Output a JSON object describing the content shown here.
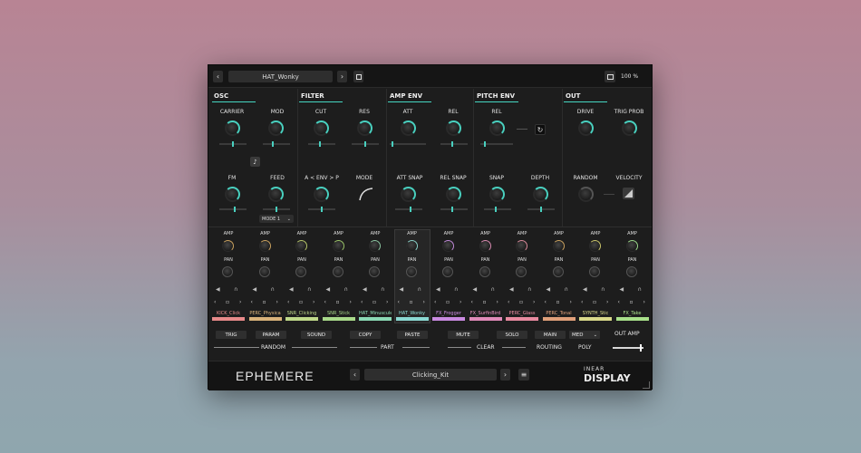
{
  "top": {
    "preset": "HAT_Wonky",
    "zoom": "100 %"
  },
  "sections": {
    "osc": "OSC",
    "filter": "FILTER",
    "amp_env": "AMP ENV",
    "pitch_env": "PITCH ENV",
    "out": "OUT"
  },
  "osc": {
    "carrier": "CARRIER",
    "mod": "MOD",
    "fm": "FM",
    "feed": "FEED",
    "mode": "MODE 1"
  },
  "filter": {
    "cut": "CUT",
    "res": "RES",
    "env": "A < ENV > P",
    "mode": "MODE"
  },
  "amp_env": {
    "att": "ATT",
    "rel": "REL",
    "att_snap": "ATT SNAP",
    "rel_snap": "REL SNAP"
  },
  "pitch_env": {
    "rel": "REL",
    "snap": "SNAP",
    "depth": "DEPTH"
  },
  "out": {
    "drive": "DRIVE",
    "trig_prob": "TRIG PROB",
    "random": "RANDOM",
    "velocity": "VELOCITY"
  },
  "channel_labels": {
    "amp": "AMP",
    "pan": "PAN"
  },
  "channels": [
    {
      "name": "KICK_Click",
      "color": "#e88a8a"
    },
    {
      "name": "PERC_Physica",
      "color": "#d9b27a"
    },
    {
      "name": "SNR_Clicking",
      "color": "#bfd98a"
    },
    {
      "name": "SNR_Stick",
      "color": "#a8d98a"
    },
    {
      "name": "HAT_Minuscule",
      "color": "#8ad9b4"
    },
    {
      "name": "HAT_Wonky",
      "color": "#8ad9d2"
    },
    {
      "name": "FX_Frogger",
      "color": "#c98ae0"
    },
    {
      "name": "FX_SurfinBird",
      "color": "#e08ab9"
    },
    {
      "name": "PERC_Glass",
      "color": "#e88aa0"
    },
    {
      "name": "PERC_Tonal",
      "color": "#e0a07a"
    },
    {
      "name": "SYNTH_Stic",
      "color": "#d9d98a"
    },
    {
      "name": "FX_Take",
      "color": "#a8e08a"
    }
  ],
  "bottom": {
    "trig": "TRIG",
    "param": "PARAM",
    "sound": "SOUND",
    "random": "RANDOM",
    "copy": "COPY",
    "paste": "PASTE",
    "part": "PART",
    "mute": "MUTE",
    "solo": "SOLO",
    "clear": "CLEAR",
    "main": "MAIN",
    "routing": "ROUTING",
    "poly": "POLY",
    "poly_value": "MED",
    "out_amp": "OUT AMP"
  },
  "footer": {
    "logo": "EPHEMERE",
    "kit": "Clicking_Kit",
    "brand_top": "INEAR",
    "brand_bottom": "DISPLAY"
  }
}
